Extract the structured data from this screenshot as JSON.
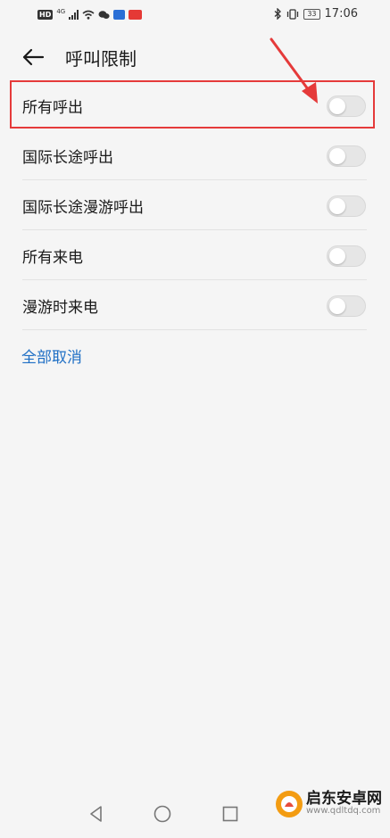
{
  "status_bar": {
    "left_label": "HD",
    "network": "4G",
    "time": "17:06",
    "battery": "33"
  },
  "header": {
    "title": "呼叫限制"
  },
  "settings": [
    {
      "label": "所有呼出",
      "enabled": false
    },
    {
      "label": "国际长途呼出",
      "enabled": false
    },
    {
      "label": "国际长途漫游呼出",
      "enabled": false
    },
    {
      "label": "所有来电",
      "enabled": false
    },
    {
      "label": "漫游时来电",
      "enabled": false
    }
  ],
  "cancel_all_label": "全部取消",
  "annotation": {
    "highlight_color": "#e53a3a"
  },
  "watermark": {
    "brand": "启东安卓网",
    "url": "www.qdltdq.com"
  },
  "colors": {
    "accent": "#1f6fc5",
    "toggle_off": "#e6e6e6"
  }
}
